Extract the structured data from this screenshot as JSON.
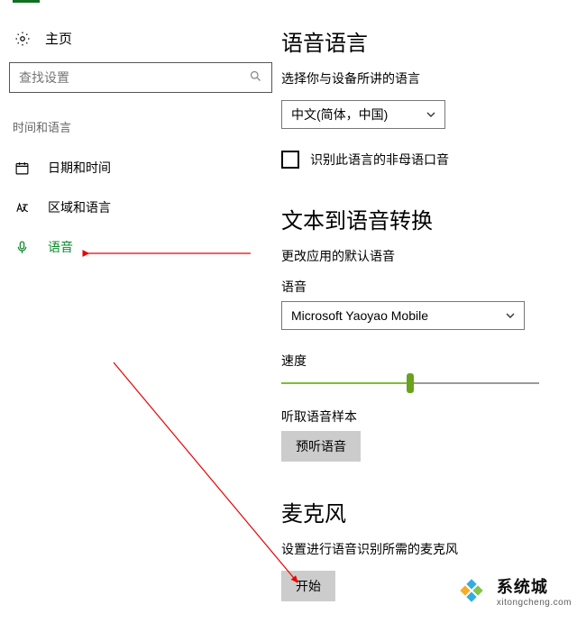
{
  "sidebar": {
    "home": "主页",
    "search_placeholder": "查找设置",
    "group_title": "时间和语言",
    "items": [
      {
        "label": "日期和时间"
      },
      {
        "label": "区域和语言"
      },
      {
        "label": "语音"
      }
    ]
  },
  "speech_lang": {
    "heading": "语音语言",
    "desc": "选择你与设备所讲的语言",
    "dropdown_value": "中文(简体，中国)",
    "checkbox_label": "识别此语言的非母语口音"
  },
  "tts": {
    "heading": "文本到语音转换",
    "desc": "更改应用的默认语音",
    "voice_label": "语音",
    "voice_value": "Microsoft Yaoyao Mobile",
    "speed_label": "速度",
    "speed_percent": 50,
    "sample_label": "听取语音样本",
    "preview_btn": "预听语音"
  },
  "mic": {
    "heading": "麦克风",
    "desc": "设置进行语音识别所需的麦克风",
    "start_btn": "开始"
  },
  "watermark": {
    "name": "系统城",
    "url": "xitongcheng.com"
  },
  "colors": {
    "accent": "#0d8a2c",
    "slider": "#7ebd34"
  }
}
